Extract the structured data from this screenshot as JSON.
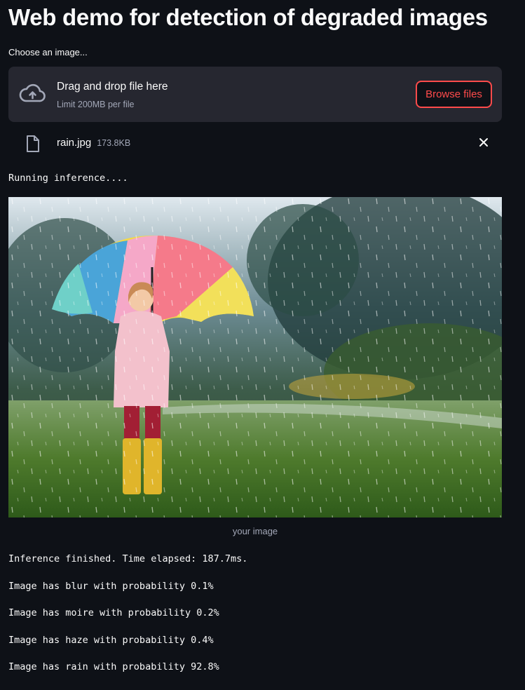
{
  "header": {
    "title": "Web demo for detection of degraded images"
  },
  "uploader": {
    "label": "Choose an image...",
    "drop_text": "Drag and drop file here",
    "limit_text": "Limit 200MB per file",
    "browse_label": "Browse files"
  },
  "file": {
    "name": "rain.jpg",
    "size": "173.8KB"
  },
  "status": {
    "running": "Running inference....",
    "finished": "Inference finished. Time elapsed: 187.7ms."
  },
  "image": {
    "caption": "your image"
  },
  "results": [
    "Image has blur with probability 0.1%",
    "Image has moire with probability 0.2%",
    "Image has haze with probability 0.4%",
    "Image has rain with probability 92.8%"
  ],
  "colors": {
    "background": "#0e1117",
    "panel": "#262730",
    "accent": "#ff4b4b"
  }
}
